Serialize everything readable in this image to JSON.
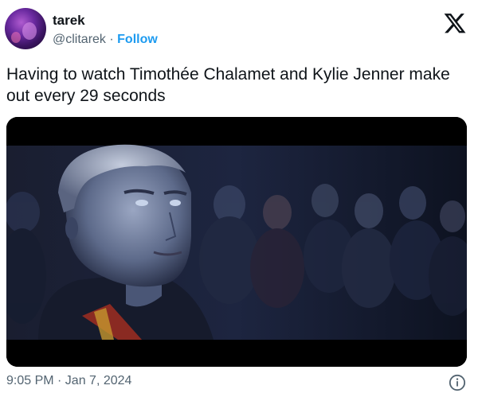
{
  "author": {
    "name": "tarek",
    "handle": "@clitarek",
    "separator": "·",
    "follow_label": "Follow"
  },
  "tweet": {
    "text": "Having to watch Timothée Chalamet and Kylie Jenner make out every 29 seconds",
    "timestamp": "9:05 PM · Jan 7, 2024"
  },
  "icons": {
    "platform": "x-logo-icon",
    "info": "info-icon"
  },
  "colors": {
    "link": "#1d9bf0",
    "secondary_text": "#536471",
    "primary_text": "#0f1419"
  }
}
